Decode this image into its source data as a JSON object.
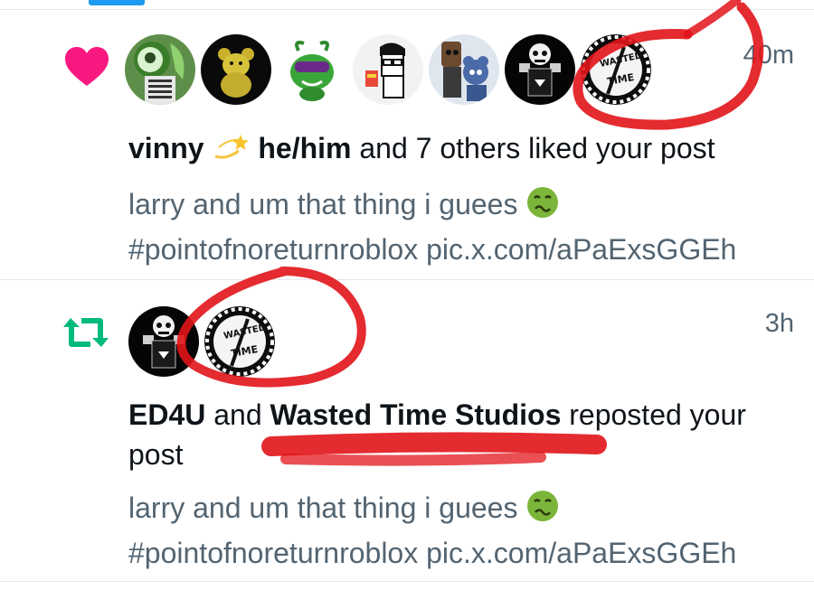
{
  "colors": {
    "like": "#f91880",
    "repost": "#00ba7c",
    "accent": "#1d9bf0",
    "muted": "#536471",
    "text": "#0f1419",
    "annotation": "#e1141a"
  },
  "notifications": [
    {
      "type": "like",
      "icon": "heart-icon",
      "time": "40m",
      "avatars": [
        "green-character-avatar",
        "yellow-bear-avatar",
        "purple-goggle-creature-avatar",
        "cartoon-boy-avatar",
        "animatronic-duo-avatar",
        "skull-character-avatar",
        "wasted-time-logo-avatar"
      ],
      "actor_name": "vinny",
      "actor_pronouns": "he/him",
      "action_text": " and 7 others liked your post",
      "preview_text": "larry and um that thing i guees",
      "preview_link": "#pointofnoreturnroblox pic.x.com/aPaExsGGEh"
    },
    {
      "type": "repost",
      "icon": "repost-icon",
      "time": "3h",
      "avatars": [
        "skull-character-avatar",
        "wasted-time-logo-avatar"
      ],
      "actor_one": "ED4U",
      "joiner": " and ",
      "actor_two": "Wasted Time Studios",
      "action_text": " reposted your post",
      "preview_text": "larry and um that thing i guees",
      "preview_link": "#pointofnoreturnroblox pic.x.com/aPaExsGGEh"
    }
  ]
}
